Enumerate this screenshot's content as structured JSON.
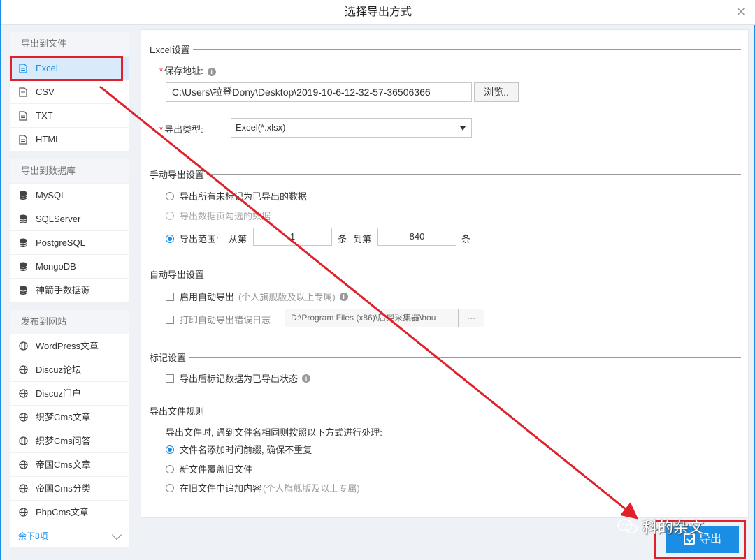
{
  "dialog": {
    "title": "选择导出方式",
    "close": "×"
  },
  "sidebar": {
    "groups": [
      {
        "title": "导出到文件",
        "items": [
          "Excel",
          "CSV",
          "TXT",
          "HTML"
        ]
      },
      {
        "title": "导出到数据库",
        "items": [
          "MySQL",
          "SQLServer",
          "PostgreSQL",
          "MongoDB",
          "神箭手数据源"
        ]
      },
      {
        "title": "发布到网站",
        "items": [
          "WordPress文章",
          "Discuz论坛",
          "Discuz门户",
          "织梦Cms文章",
          "织梦Cms问答",
          "帝国Cms文章",
          "帝国Cms分类",
          "PhpCms文章"
        ]
      }
    ],
    "more": "余下8项",
    "active": "Excel"
  },
  "excel": {
    "section": "Excel设置",
    "save_path_label": "保存地址:",
    "save_path_value": "C:\\Users\\拉登Dony\\Desktop\\2019-10-6-12-32-57-36506366",
    "browse": "浏览..",
    "type_label": "导出类型:",
    "type_value": "Excel(*.xlsx)",
    "required_mark": "*"
  },
  "manual": {
    "section": "手动导出设置",
    "opt_all": "导出所有未标记为已导出的数据",
    "opt_checked": "导出数据页勾选的数据",
    "opt_range": "导出范围:",
    "from": "从第",
    "from_value": "1",
    "unit1": "条",
    "to": "到第",
    "to_value": "840",
    "unit2": "条"
  },
  "auto": {
    "section": "自动导出设置",
    "enable": "启用自动导出",
    "enable_note": "(个人旗舰版及以上专属)",
    "log": "打印自动导出错误日志",
    "log_path": "D:\\Program Files (x86)\\后羿采集器\\hou",
    "dots": "···"
  },
  "mark": {
    "section": "标记设置",
    "after": "导出后标记数据为已导出状态"
  },
  "rule": {
    "section": "导出文件规则",
    "desc": "导出文件时, 遇到文件名相同则按照以下方式进行处理:",
    "opt1": "文件名添加时间前缀, 确保不重复",
    "opt2": "新文件覆盖旧文件",
    "opt3": "在旧文件中追加内容",
    "opt3_note": "(个人旗舰版及以上专属)"
  },
  "footer": {
    "export": "导出"
  },
  "watermark": "科的杂文",
  "colors": {
    "accent": "#1a8ee5",
    "annotation": "#e0202b"
  }
}
